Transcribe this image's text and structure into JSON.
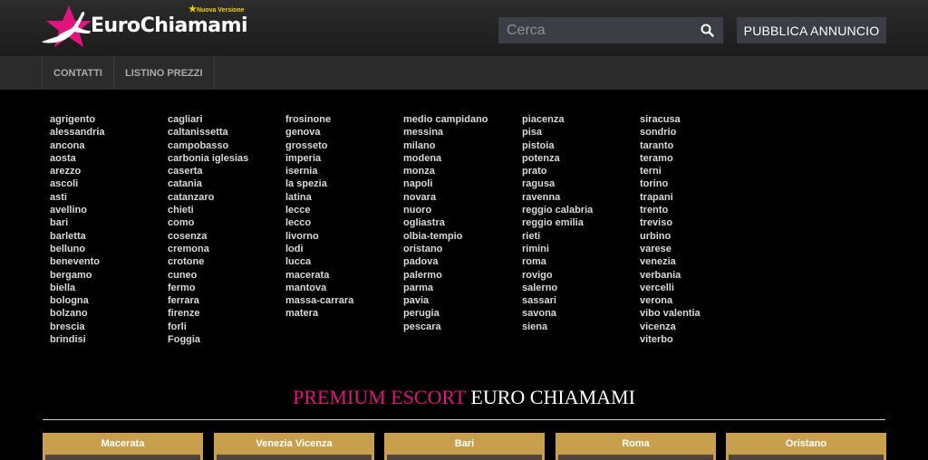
{
  "header": {
    "logo_text": "EuroChiamami",
    "logo_badge": "Nuova Versione",
    "search_placeholder": "Cerca",
    "publish_label": "PUBBLICA ANNUNCIO",
    "search_icon": "search-icon"
  },
  "subnav": {
    "items": [
      "CONTATTI",
      "LISTINO PREZZI"
    ]
  },
  "cities": [
    [
      "agrigento",
      "alessandria",
      "ancona",
      "aosta",
      "arezzo",
      "ascoli",
      "asti",
      "avellino",
      "bari",
      "barletta",
      "belluno",
      "benevento",
      "bergamo",
      "biella",
      "bologna",
      "bolzano",
      "brescia",
      "brindisi"
    ],
    [
      "cagliari",
      "caltanissetta",
      "campobasso",
      "carbonia iglesias",
      "caserta",
      "catania",
      "catanzaro",
      "chieti",
      "como",
      "cosenza",
      "cremona",
      "crotone",
      "cuneo",
      "fermo",
      "ferrara",
      "firenze",
      "forli",
      "Foggia"
    ],
    [
      "frosinone",
      "genova",
      "grosseto",
      "imperia",
      "isernia",
      "la spezia",
      "latina",
      "lecce",
      "lecco",
      "livorno",
      "lodi",
      "lucca",
      "macerata",
      "mantova",
      "massa-carrara",
      "matera"
    ],
    [
      "medio campidano",
      "messina",
      "milano",
      "modena",
      "monza",
      "napoli",
      "novara",
      "nuoro",
      "ogliastra",
      "olbia-tempio",
      "oristano",
      "padova",
      "palermo",
      "parma",
      "pavia",
      "perugia",
      "pescara"
    ],
    [
      "piacenza",
      "pisa",
      "pistoia",
      "potenza",
      "prato",
      "ragusa",
      "ravenna",
      "reggio calabria",
      "reggio emilia",
      "rieti",
      "rimini",
      "roma",
      "rovigo",
      "salerno",
      "sassari",
      "savona",
      "siena"
    ],
    [
      "siracusa",
      "sondrio",
      "taranto",
      "teramo",
      "terni",
      "torino",
      "trapani",
      "trento",
      "treviso",
      "urbino",
      "varese",
      "venezia",
      "verbania",
      "vercelli",
      "verona",
      "vibo valentia",
      "vicenza",
      "viterbo"
    ]
  ],
  "premium": {
    "pink": "PREMIUM ESCORT",
    "white": "EURO CHIAMAMI"
  },
  "cards": [
    "Macerata",
    "Venezia Vicenza",
    "Bari",
    "Roma",
    "Oristano"
  ],
  "colors": {
    "accent_pink": "#e0147e",
    "card_gold": "#c8a04d",
    "badge_yellow": "#f5d000"
  }
}
